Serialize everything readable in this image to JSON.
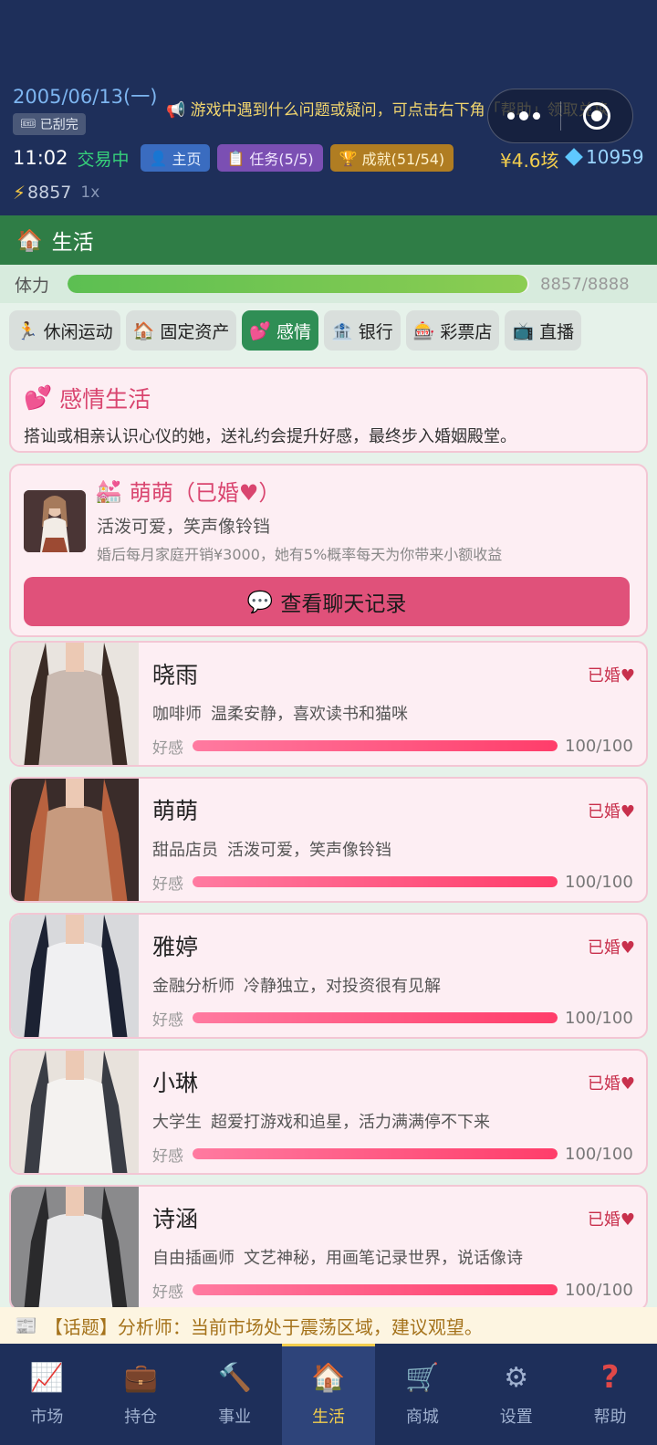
{
  "header": {
    "date": "2005/06/13(一)",
    "scratch_badge": "已刮完",
    "marquee": "游戏中遇到什么问题或疑问，可点击右下角「帮助」领取兑换",
    "time": "11:02",
    "trade_status": "交易中",
    "home_label": "主页",
    "task_label": "任务(5/5)",
    "achievement_label": "成就(51/54)",
    "money": "¥4.6垓",
    "gems": "10959",
    "energy": "8857",
    "multiplier": "1x"
  },
  "section": {
    "title": "生活"
  },
  "stamina": {
    "label": "体力",
    "value": "8857/8888",
    "current": 8857,
    "max": 8888
  },
  "tabs": [
    {
      "label": "休闲运动",
      "icon": "🏃"
    },
    {
      "label": "固定资产",
      "icon": "🏠"
    },
    {
      "label": "感情",
      "icon": "💕"
    },
    {
      "label": "银行",
      "icon": "🏦"
    },
    {
      "label": "彩票店",
      "icon": "🎰"
    },
    {
      "label": "直播",
      "icon": "📺"
    }
  ],
  "intro": {
    "title": "感情生活",
    "description": "搭讪或相亲认识心仪的她，送礼约会提升好感，最终步入婚姻殿堂。"
  },
  "spouse": {
    "name": "萌萌（已婚♥）",
    "desc": "活泼可爱，笑声像铃铛",
    "note": "婚后每月家庭开销¥3000，她有5%概率每天为你带来小额收益",
    "chat_button": "查看聊天记录"
  },
  "girls": [
    {
      "name": "晓雨",
      "status": "已婚♥",
      "job": "咖啡师",
      "desc": "温柔安静，喜欢读书和猫咪",
      "fav_label": "好感",
      "fav": "100/100",
      "fav_frac": 1.0,
      "colors": [
        "#e9e4df",
        "#c9b9b0",
        "#3a2b25"
      ]
    },
    {
      "name": "萌萌",
      "status": "已婚♥",
      "job": "甜品店员",
      "desc": "活泼可爱，笑声像铃铛",
      "fav_label": "好感",
      "fav": "100/100",
      "fav_frac": 1.0,
      "colors": [
        "#3a2c2a",
        "#c79a7e",
        "#b8623f"
      ]
    },
    {
      "name": "雅婷",
      "status": "已婚♥",
      "job": "金融分析师",
      "desc": "冷静独立，对投资很有见解",
      "fav_label": "好感",
      "fav": "100/100",
      "fav_frac": 1.0,
      "colors": [
        "#d8d9dc",
        "#f0f0f2",
        "#1c2233"
      ]
    },
    {
      "name": "小琳",
      "status": "已婚♥",
      "job": "大学生",
      "desc": "超爱打游戏和追星，活力满满停不下来",
      "fav_label": "好感",
      "fav": "100/100",
      "fav_frac": 1.0,
      "colors": [
        "#e8e2dc",
        "#f4f2f0",
        "#3a3d45"
      ]
    },
    {
      "name": "诗涵",
      "status": "已婚♥",
      "job": "自由插画师",
      "desc": "文艺神秘，用画笔记录世界，说话像诗",
      "fav_label": "好感",
      "fav": "100/100",
      "fav_frac": 1.0,
      "colors": [
        "#8a8a8c",
        "#e9e9ea",
        "#2a2a2c"
      ]
    }
  ],
  "news": "【话题】分析师：当前市场处于震荡区域，建议观望。",
  "nav": [
    {
      "label": "市场",
      "icon": "📈",
      "name": "chart-icon"
    },
    {
      "label": "持仓",
      "icon": "💼",
      "name": "briefcase-icon"
    },
    {
      "label": "事业",
      "icon": "🔨",
      "name": "hammer-icon"
    },
    {
      "label": "生活",
      "icon": "🏠",
      "name": "house-icon"
    },
    {
      "label": "商城",
      "icon": "🛒",
      "name": "cart-icon"
    },
    {
      "label": "设置",
      "icon": "⚙",
      "name": "gear-icon"
    },
    {
      "label": "帮助",
      "icon": "?",
      "name": "help-icon"
    }
  ],
  "active_tab": 2,
  "active_nav": 3
}
